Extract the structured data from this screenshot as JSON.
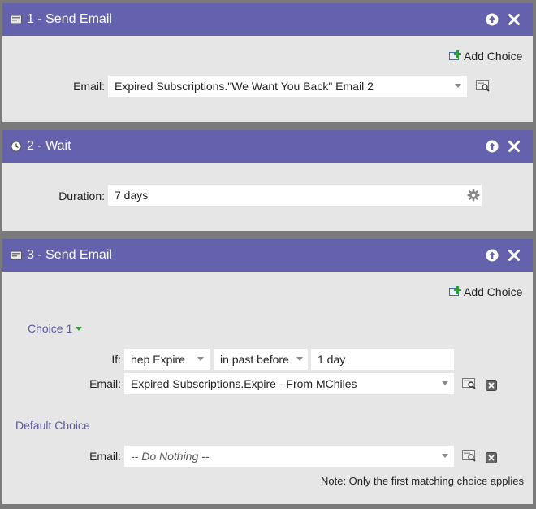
{
  "steps": [
    {
      "title": "1 - Send Email",
      "header_icon": "email-icon",
      "add_choice_label": "Add Choice",
      "email_label": "Email:",
      "email_value": "Expired Subscriptions.\"We Want You Back\" Email 2"
    },
    {
      "title": "2 - Wait",
      "header_icon": "clock-icon",
      "duration_label": "Duration:",
      "duration_value": "7 days"
    },
    {
      "title": "3 - Send Email",
      "header_icon": "email-icon",
      "add_choice_label": "Add Choice",
      "choice1": {
        "title": "Choice 1",
        "if_label": "If:",
        "if_field": "hep Expire",
        "if_operator": "in past before",
        "if_value": "1 day",
        "email_label": "Email:",
        "email_value": "Expired Subscriptions.Expire - From MChiles"
      },
      "default_choice": {
        "title": "Default Choice",
        "email_label": "Email:",
        "email_value": "-- Do Nothing --"
      },
      "note": "Note: Only the first matching choice applies"
    }
  ],
  "colors": {
    "header": "#6461ad",
    "panel": "#e6e6e6",
    "link": "#5a5aa0"
  }
}
